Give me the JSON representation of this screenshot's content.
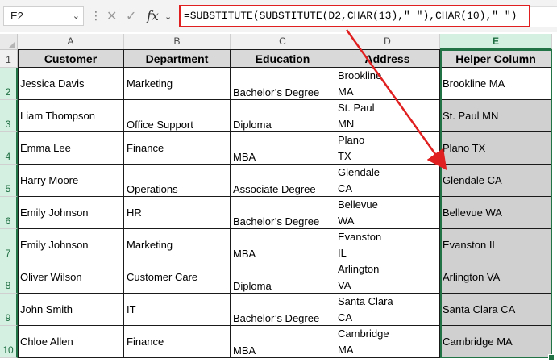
{
  "namebox": {
    "value": "E2"
  },
  "formula_bar": {
    "formula": "=SUBSTITUTE(SUBSTITUTE(D2,CHAR(13),\" \"),CHAR(10),\" \")"
  },
  "column_letters": [
    "A",
    "B",
    "C",
    "D",
    "E"
  ],
  "row_numbers": [
    "1",
    "2",
    "3",
    "4",
    "5",
    "6",
    "7",
    "8",
    "9",
    "10"
  ],
  "headers": [
    "Customer",
    "Department",
    "Education",
    "Address",
    "Helper Column"
  ],
  "rows": [
    {
      "customer": "Jessica Davis",
      "department": "Marketing",
      "education": "Bachelor’s Degree",
      "address_line1": "Brookline",
      "address_line2": "MA",
      "helper": "Brookline MA"
    },
    {
      "customer": "Liam Thompson",
      "department": "Office Support",
      "education": "Diploma",
      "address_line1": "St. Paul",
      "address_line2": "MN",
      "helper": "St. Paul MN"
    },
    {
      "customer": "Emma Lee",
      "department": "Finance",
      "education": "MBA",
      "address_line1": "Plano",
      "address_line2": "TX",
      "helper": "Plano TX"
    },
    {
      "customer": "Harry Moore",
      "department": "Operations",
      "education": "Associate Degree",
      "address_line1": "Glendale",
      "address_line2": "CA",
      "helper": "Glendale CA"
    },
    {
      "customer": "Emily Johnson",
      "department": "HR",
      "education": "Bachelor’s Degree",
      "address_line1": "Bellevue",
      "address_line2": "WA",
      "helper": "Bellevue WA"
    },
    {
      "customer": "Emily Johnson",
      "department": "Marketing",
      "education": "MBA",
      "address_line1": "Evanston",
      "address_line2": "IL",
      "helper": "Evanston IL"
    },
    {
      "customer": "Oliver Wilson",
      "department": "Customer Care",
      "education": "Diploma",
      "address_line1": "Arlington",
      "address_line2": "VA",
      "helper": "Arlington VA"
    },
    {
      "customer": "John Smith",
      "department": "IT",
      "education": "Bachelor’s Degree",
      "address_line1": "Santa Clara",
      "address_line2": "CA",
      "helper": "Santa Clara CA"
    },
    {
      "customer": "Chloe Allen",
      "department": "Finance",
      "education": "MBA",
      "address_line1": "Cambridge",
      "address_line2": "MA",
      "helper": "Cambridge MA"
    }
  ],
  "colors": {
    "accent": "#217346",
    "highlight": "#e02020",
    "header_fill": "#d9d9d9",
    "helper_fill": "#d0d0d0"
  },
  "icons": [
    "chevron-down-icon",
    "more-dots-icon",
    "cancel-icon",
    "enter-icon",
    "function-icon"
  ]
}
